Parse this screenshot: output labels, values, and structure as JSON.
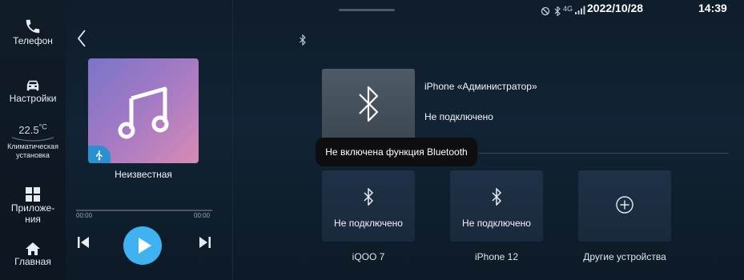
{
  "nav": {
    "phone_label": "Телефон",
    "settings_label": "Настройки",
    "temperature_value": "22.5",
    "temperature_unit": "°C",
    "climate_label_1": "Климатическая",
    "climate_label_2": "установка",
    "apps_label_1": "Приложе-",
    "apps_label_2": "ния",
    "home_label": "Главная"
  },
  "media": {
    "track_title": "Неизвестная",
    "elapsed": "00:00",
    "duration": "00:00",
    "progress": 0
  },
  "status_bar": {
    "signal": "4G",
    "date": "2022/10/28",
    "time": "14:39"
  },
  "bluetooth": {
    "device_name": "iPhone «Администратор»",
    "device_status": "Не подключено",
    "toast": "Не включена функция Bluetooth",
    "devices": [
      {
        "state": "Не подключено",
        "name": "iQOO 7"
      },
      {
        "state": "Не подключено",
        "name": "iPhone 12"
      }
    ],
    "other_devices_label": "Другие устройства"
  },
  "colors": {
    "accent": "#3fb2f2",
    "background": "#112334"
  }
}
